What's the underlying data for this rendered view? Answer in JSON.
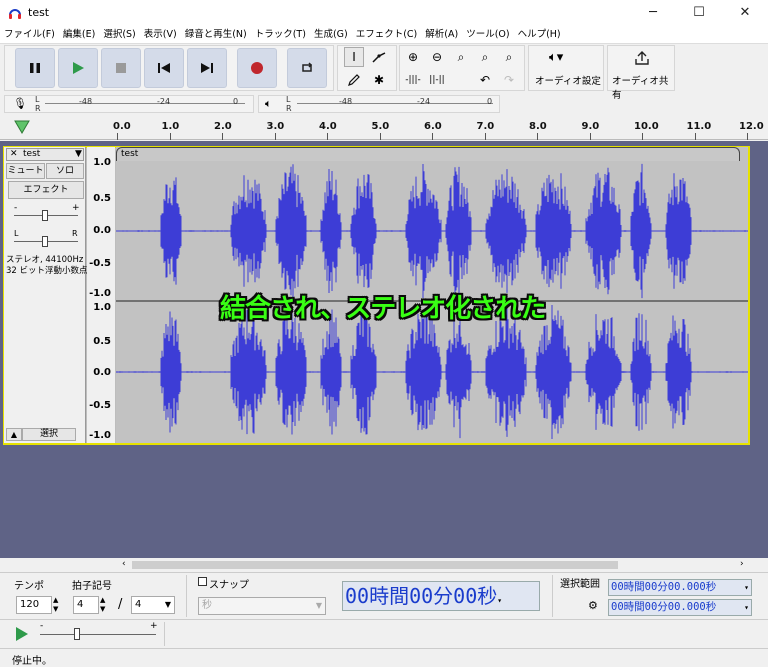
{
  "window": {
    "title": "test",
    "minimize": "─",
    "maximize": "☐",
    "close": "✕"
  },
  "menu": [
    "ファイル(F)",
    "編集(E)",
    "選択(S)",
    "表示(V)",
    "録音と再生(N)",
    "トラック(T)",
    "生成(G)",
    "エフェクト(C)",
    "解析(A)",
    "ツール(O)",
    "ヘルプ(H)"
  ],
  "toolbar": {
    "audio_setup": "オーディオ設定",
    "audio_share": "オーディオ共有"
  },
  "meters": {
    "rec_ticks": [
      "-48",
      "-24",
      "0"
    ],
    "play_ticks": [
      "-48",
      "-24",
      "0"
    ],
    "lr": [
      "L",
      "R"
    ]
  },
  "ruler": {
    "ticks": [
      "0.0",
      "1.0",
      "2.0",
      "3.0",
      "4.0",
      "5.0",
      "6.0",
      "7.0",
      "8.0",
      "9.0",
      "10.0",
      "11.0",
      "12.0"
    ]
  },
  "track": {
    "name": "test",
    "close": "✕",
    "mute": "ミュート",
    "solo": "ソロ",
    "effects": "エフェクト",
    "gain_minus": "-",
    "gain_plus": "+",
    "pan_l": "L",
    "pan_r": "R",
    "info1": "ステレオ, 44100Hz",
    "info2": "32 ビット浮動小数点数",
    "select": "選択",
    "collapse": "▲",
    "clip_name": "test",
    "scale_top": [
      "1.0",
      "0.5",
      "0.0",
      "-0.5",
      "-1.0"
    ],
    "scale_bottom": [
      "1.0",
      "0.5",
      "0.0",
      "-0.5",
      "-1.0"
    ]
  },
  "overlay": "結合され、ステレオ化された",
  "bottom": {
    "tempo_label": "テンポ",
    "tempo_value": "120",
    "time_sig_label": "拍子記号",
    "beats": "4",
    "slash": "/",
    "beat_unit": "4",
    "snap_label": "スナップ",
    "snap_unit": "秒",
    "time_display": "00時間00分00秒",
    "selection_label": "選択範囲",
    "sel_start": "00時間00分00.000秒",
    "sel_end": "00時間00分00.000秒",
    "speed_minus": "-",
    "speed_plus": "+"
  },
  "status": "停止中。",
  "colors": {
    "waveform": "#3d3dd6",
    "track_bg": "#c2c2c2",
    "track_area": "#5f6386",
    "selected_border": "#e6e200",
    "overlay_text": "#39ff14"
  }
}
